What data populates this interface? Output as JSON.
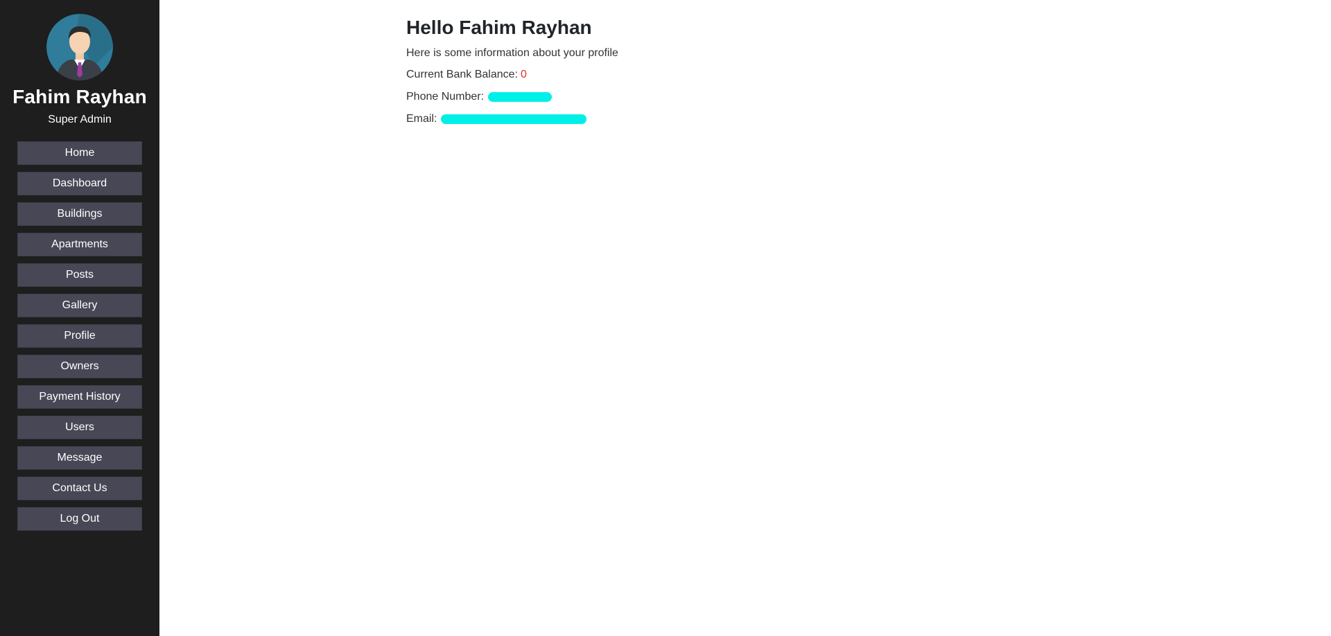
{
  "sidebar": {
    "avatar_icon": "user-avatar-icon",
    "user_name": "Fahim Rayhan",
    "user_role": "Super Admin",
    "items": [
      {
        "label": "Home"
      },
      {
        "label": "Dashboard"
      },
      {
        "label": "Buildings"
      },
      {
        "label": "Apartments"
      },
      {
        "label": "Posts"
      },
      {
        "label": "Gallery"
      },
      {
        "label": "Profile"
      },
      {
        "label": "Owners"
      },
      {
        "label": "Payment History"
      },
      {
        "label": "Users"
      },
      {
        "label": "Message"
      },
      {
        "label": "Contact Us"
      },
      {
        "label": "Log Out"
      }
    ]
  },
  "main": {
    "greeting": "Hello Fahim Rayhan",
    "subtitle": "Here is some information about your profile",
    "balance_label": "Current Bank Balance:",
    "balance_value": "0",
    "phone_label": "Phone Number:",
    "email_label": "Email:"
  },
  "colors": {
    "sidebar_bg": "#1e1e1e",
    "nav_item_bg": "#474756",
    "balance_value": "#e03131",
    "redaction": "#00f0e8"
  }
}
